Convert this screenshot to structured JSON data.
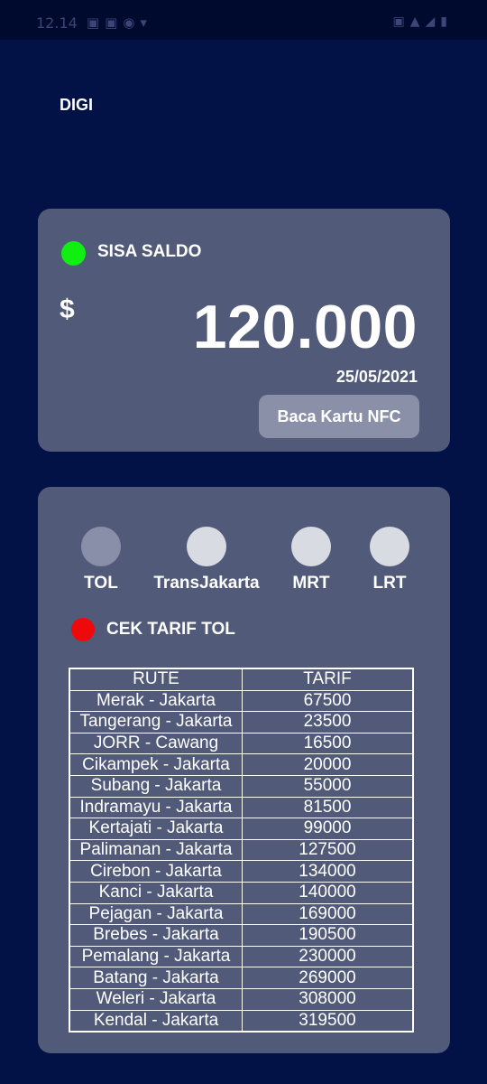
{
  "app": {
    "title": "DIGI"
  },
  "balance": {
    "label": "SISA SALDO",
    "currency": "$",
    "amount": "120.000",
    "date": "25/05/2021",
    "nfc_button": "Baca Kartu NFC"
  },
  "modes": [
    {
      "label": "TOL",
      "active": true
    },
    {
      "label": "TransJakarta",
      "active": false
    },
    {
      "label": "MRT",
      "active": false
    },
    {
      "label": "LRT",
      "active": false
    }
  ],
  "tarif": {
    "title": "CEK TARIF TOL",
    "headers": [
      "RUTE",
      "TARIF"
    ],
    "rows": [
      [
        "Merak - Jakarta",
        "67500"
      ],
      [
        "Tangerang - Jakarta",
        "23500"
      ],
      [
        "JORR - Cawang",
        "16500"
      ],
      [
        "Cikampek - Jakarta",
        "20000"
      ],
      [
        "Subang - Jakarta",
        "55000"
      ],
      [
        "Indramayu - Jakarta",
        "81500"
      ],
      [
        "Kertajati - Jakarta",
        "99000"
      ],
      [
        "Palimanan - Jakarta",
        "127500"
      ],
      [
        "Cirebon - Jakarta",
        "134000"
      ],
      [
        "Kanci - Jakarta",
        "140000"
      ],
      [
        "Pejagan - Jakarta",
        "169000"
      ],
      [
        "Brebes - Jakarta",
        "190500"
      ],
      [
        "Pemalang - Jakarta",
        "230000"
      ],
      [
        "Batang - Jakarta",
        "269000"
      ],
      [
        "Weleri - Jakarta",
        "308000"
      ],
      [
        "Kendal - Jakarta",
        "319500"
      ]
    ]
  },
  "colors": {
    "background": "#021247",
    "card": "#515b79",
    "status_green": "#11ee11",
    "status_red": "#ee0a0a",
    "mode_active": "#8a8fa9",
    "mode_inactive": "#d9dbe3"
  }
}
